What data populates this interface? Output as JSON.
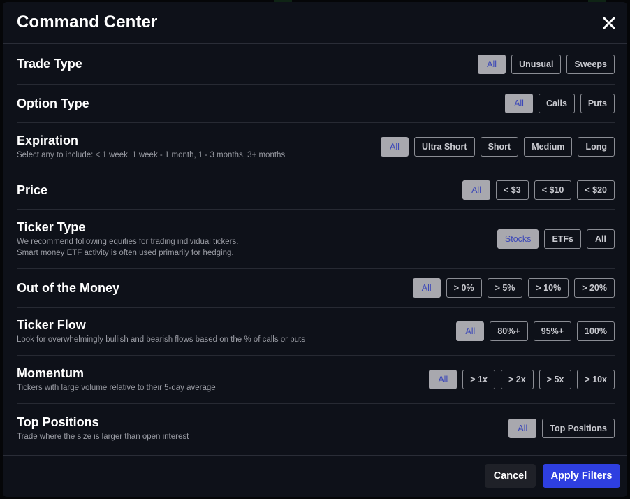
{
  "modal": {
    "title": "Command Center",
    "close_icon": "close-icon"
  },
  "colors": {
    "active_option_bg": "#a8a8ae",
    "active_option_text": "#3c48b8",
    "apply_button": "#2e3fe0",
    "modal_bg": "#0e1119"
  },
  "filters": [
    {
      "title": "Trade Type",
      "description": "",
      "options": [
        "All",
        "Unusual",
        "Sweeps"
      ],
      "selected": "All"
    },
    {
      "title": "Option Type",
      "description": "",
      "options": [
        "All",
        "Calls",
        "Puts"
      ],
      "selected": "All"
    },
    {
      "title": "Expiration",
      "description": "Select any to include: < 1 week, 1 week - 1 month, 1 - 3 months, 3+ months",
      "options": [
        "All",
        "Ultra Short",
        "Short",
        "Medium",
        "Long"
      ],
      "selected": "All"
    },
    {
      "title": "Price",
      "description": "",
      "options": [
        "All",
        "< $3",
        "< $10",
        "< $20"
      ],
      "selected": "All"
    },
    {
      "title": "Ticker Type",
      "description": "We recommend following equities for trading individual tickers.",
      "description2": "Smart money ETF activity is often used primarily for hedging.",
      "options": [
        "Stocks",
        "ETFs",
        "All"
      ],
      "selected": "Stocks"
    },
    {
      "title": "Out of the Money",
      "description": "",
      "options": [
        "All",
        "> 0%",
        "> 5%",
        "> 10%",
        "> 20%"
      ],
      "selected": "All"
    },
    {
      "title": "Ticker Flow",
      "description": "Look for overwhelmingly bullish and bearish flows based on the % of calls or puts",
      "options": [
        "All",
        "80%+",
        "95%+",
        "100%"
      ],
      "selected": "All"
    },
    {
      "title": "Momentum",
      "description": "Tickers with large volume relative to their 5-day average",
      "options": [
        "All",
        "> 1x",
        "> 2x",
        "> 5x",
        "> 10x"
      ],
      "selected": "All"
    },
    {
      "title": "Top Positions",
      "description": "Trade where the size is larger than open interest",
      "options": [
        "All",
        "Top Positions"
      ],
      "selected": "All"
    }
  ],
  "footer": {
    "cancel_label": "Cancel",
    "apply_label": "Apply Filters"
  }
}
